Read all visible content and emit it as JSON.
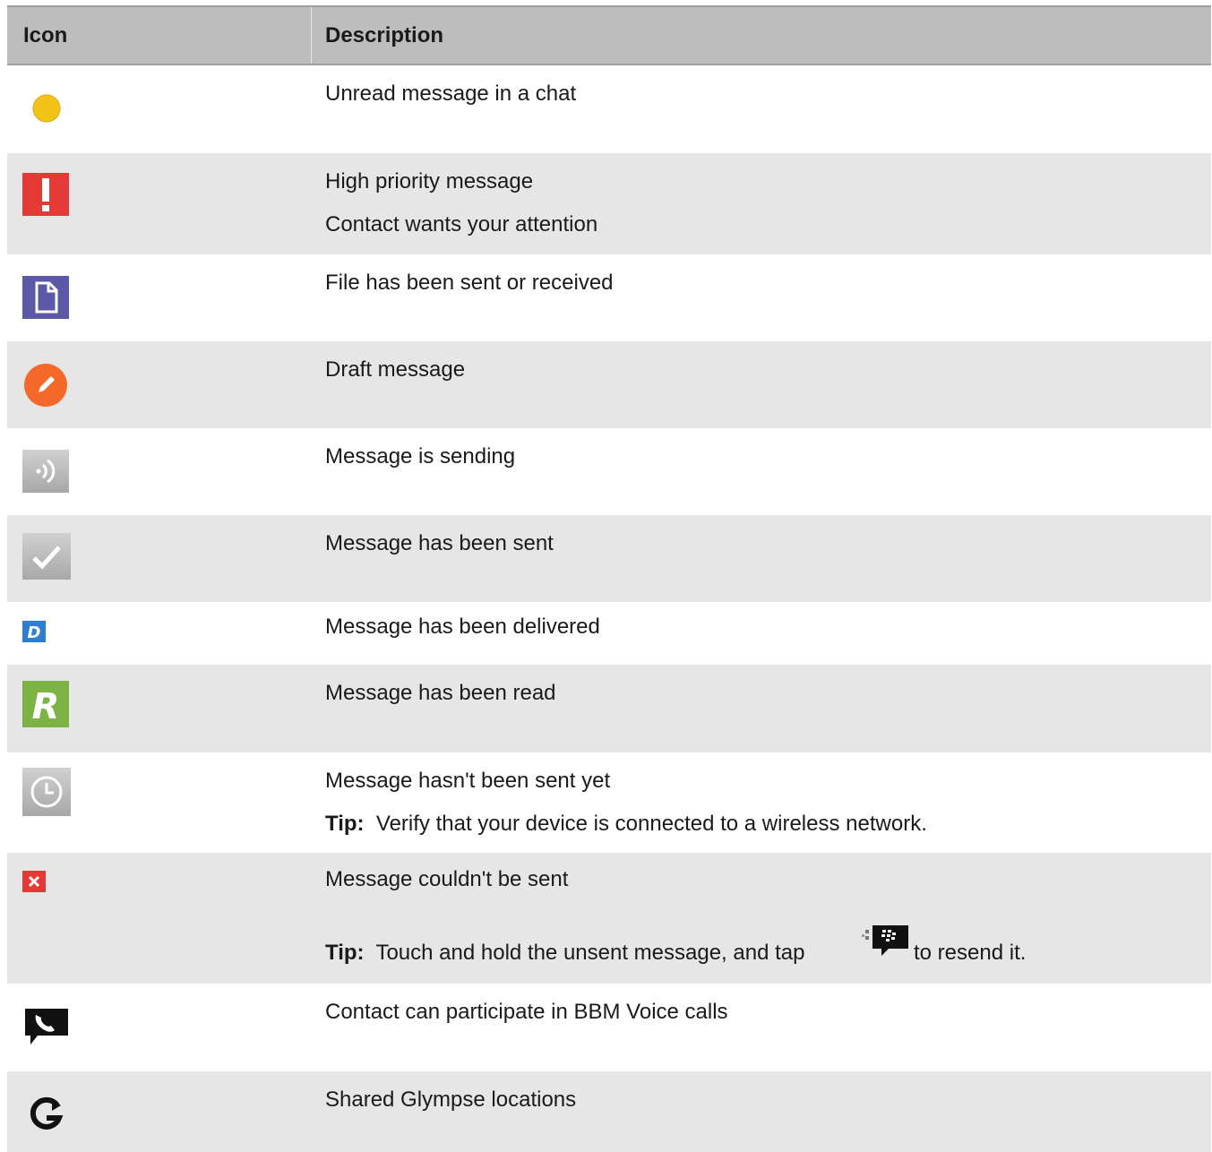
{
  "header": {
    "icon_col": "Icon",
    "desc_col": "Description"
  },
  "rows": [
    {
      "icon": "yellow-dot-icon",
      "lines": [
        "Unread message in a chat"
      ]
    },
    {
      "icon": "exclamation-icon",
      "lines": [
        "High priority message",
        "Contact wants your attention"
      ]
    },
    {
      "icon": "file-icon",
      "lines": [
        "File has been sent or received"
      ]
    },
    {
      "icon": "pencil-icon",
      "lines": [
        "Draft message"
      ]
    },
    {
      "icon": "sending-icon",
      "lines": [
        "Message is sending"
      ]
    },
    {
      "icon": "checkmark-icon",
      "lines": [
        "Message has been sent"
      ]
    },
    {
      "icon": "delivered-d-icon",
      "lines": [
        "Message has been delivered"
      ]
    },
    {
      "icon": "read-r-icon",
      "lines": [
        "Message has been read"
      ]
    },
    {
      "icon": "clock-icon",
      "lines": [
        "Message hasn't been sent yet"
      ],
      "tip_label": "Tip:",
      "tip_text": "Verify that your device is connected to a wireless network."
    },
    {
      "icon": "error-x-icon",
      "lines": [
        "Message couldn't be sent"
      ],
      "tip_label": "Tip:",
      "tip_text_before": "Touch and hold the unsent message, and tap",
      "tip_text_after": "to resend it.",
      "inline_icon": "resend-bbm-icon"
    },
    {
      "icon": "voice-call-icon",
      "lines": [
        "Contact can participate in BBM Voice calls"
      ]
    },
    {
      "icon": "glympse-icon",
      "lines": [
        "Shared Glympse locations"
      ]
    }
  ],
  "colors": {
    "header_bg": "#bdbdbd",
    "row_alt": "#e6e6e6",
    "unread": "#f2c41a",
    "priority": "#e53935",
    "file": "#5c5aa8",
    "draft": "#f4692a",
    "delivered": "#2f7fd0",
    "read": "#7cb342"
  }
}
